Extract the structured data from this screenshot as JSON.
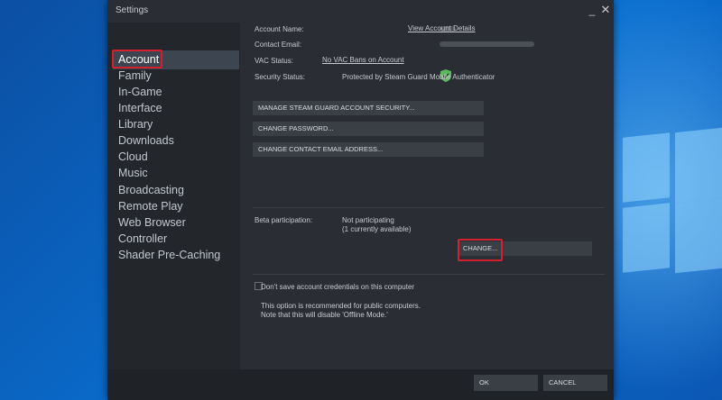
{
  "window": {
    "title": "Settings",
    "minimize_glyph": "_",
    "close_glyph": "✕"
  },
  "sidebar": {
    "items": [
      {
        "label": "Account"
      },
      {
        "label": "Family"
      },
      {
        "label": "In-Game"
      },
      {
        "label": "Interface"
      },
      {
        "label": "Library"
      },
      {
        "label": "Downloads"
      },
      {
        "label": "Cloud"
      },
      {
        "label": "Music"
      },
      {
        "label": "Broadcasting"
      },
      {
        "label": "Remote Play"
      },
      {
        "label": "Web Browser"
      },
      {
        "label": "Controller"
      },
      {
        "label": "Shader Pre-Caching"
      }
    ],
    "active": "Account"
  },
  "account": {
    "name_label": "Account Name:",
    "email_label": "Contact Email:",
    "vac_label": "VAC Status:",
    "vac_value": "No VAC Bans on Account",
    "security_label": "Security Status:",
    "security_value": "Protected by Steam Guard Mobile Authenticator",
    "view_details": "View Account Details",
    "security_icon": "shield-check-icon"
  },
  "buttons": {
    "manage_guard": "MANAGE STEAM GUARD ACCOUNT SECURITY...",
    "change_password": "CHANGE PASSWORD...",
    "change_email": "CHANGE CONTACT EMAIL ADDRESS..."
  },
  "beta": {
    "label": "Beta participation:",
    "status": "Not participating",
    "available": "(1 currently available)",
    "change": "CHANGE..."
  },
  "credentials": {
    "checkbox_label": "Don't save account credentials on this computer",
    "note_line1": "This option is recommended for public computers.",
    "note_line2": "Note that this will disable 'Offline Mode.'"
  },
  "footer": {
    "ok": "OK",
    "cancel": "CANCEL"
  },
  "colors": {
    "highlight": "#d3202f",
    "shield": "#5cb85c",
    "active_bg": "#3d4550"
  }
}
